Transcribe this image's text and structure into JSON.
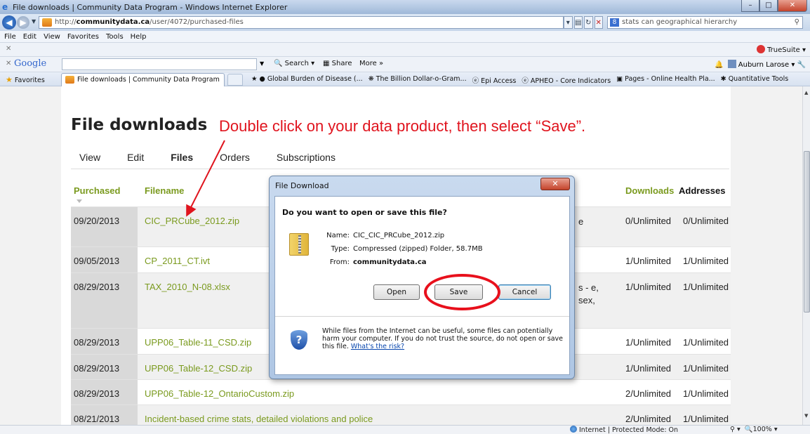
{
  "window": {
    "title": "File downloads | Community Data Program - Windows Internet Explorer"
  },
  "address": {
    "url_prefix": "http://",
    "url_host": "communitydata.ca",
    "url_path": "/user/4072/purchased-files",
    "search_value": "stats can geographical hierarchy"
  },
  "menu": [
    "File",
    "Edit",
    "View",
    "Favorites",
    "Tools",
    "Help"
  ],
  "truesuite": {
    "label": "TrueSuite"
  },
  "google_toolbar": {
    "logo": "Google",
    "search_label": "Search",
    "share_label": "Share",
    "more_label": "More »",
    "user": "Auburn Larose"
  },
  "favorites": {
    "label": "Favorites",
    "active_tab": "File downloads | Community Data Program",
    "links": [
      "Global Burden of Disease (...",
      "The Billion Dollar-o-Gram...",
      "Epi Access",
      "APHEO - Core Indicators",
      "Pages - Online Health Pla...",
      "Quantitative Tools"
    ]
  },
  "page": {
    "title": "File downloads",
    "instruction": "Double click on your data product, then select “Save”.",
    "tabs": [
      "View",
      "Edit",
      "Files",
      "Orders",
      "Subscriptions"
    ],
    "active_tab": "Files",
    "columns": {
      "purchased": "Purchased",
      "filename": "Filename",
      "downloads": "Downloads",
      "addresses": "Addresses"
    },
    "rows": [
      {
        "date": "09/20/2013",
        "file": "CIC_PRCube_2012.zip",
        "desc": "e",
        "downloads": "0/Unlimited",
        "addresses": "0/Unlimited"
      },
      {
        "date": "09/05/2013",
        "file": "CP_2011_CT.ivt",
        "desc": "",
        "downloads": "1/Unlimited",
        "addresses": "1/Unlimited"
      },
      {
        "date": "08/29/2013",
        "file": "TAX_2010_N-08.xlsx",
        "desc": "s - e, sex,",
        "downloads": "1/Unlimited",
        "addresses": "1/Unlimited"
      },
      {
        "date": "08/29/2013",
        "file": "UPP06_Table-11_CSD.zip",
        "desc": "",
        "downloads": "1/Unlimited",
        "addresses": "1/Unlimited"
      },
      {
        "date": "08/29/2013",
        "file": "UPP06_Table-12_CSD.zip",
        "desc": "",
        "downloads": "1/Unlimited",
        "addresses": "1/Unlimited"
      },
      {
        "date": "08/29/2013",
        "file": "UPP06_Table-12_OntarioCustom.zip",
        "desc": "",
        "downloads": "2/Unlimited",
        "addresses": "1/Unlimited"
      },
      {
        "date": "08/21/2013",
        "file": "Incident-based crime stats, detailed violations and police",
        "desc": "",
        "downloads": "2/Unlimited",
        "addresses": "1/Unlimited"
      }
    ]
  },
  "dialog": {
    "title": "File Download",
    "question": "Do you want to open or save this file?",
    "name_label": "Name:",
    "name_value": "CIC_CIC_PRCube_2012.zip",
    "type_label": "Type:",
    "type_value": "Compressed (zipped) Folder, 58.7MB",
    "from_label": "From:",
    "from_value": "communitydata.ca",
    "open_label": "Open",
    "save_label": "Save",
    "cancel_label": "Cancel",
    "warning": "While files from the Internet can be useful, some files can potentially harm your computer. If you do not trust the source, do not open or save this file.",
    "risk_link": "What's the risk?"
  },
  "status": {
    "zone": "Internet | Protected Mode: On",
    "zoom": "100%"
  },
  "colors": {
    "accent_green": "#7a9a1e",
    "annotation_red": "#e0141e"
  }
}
